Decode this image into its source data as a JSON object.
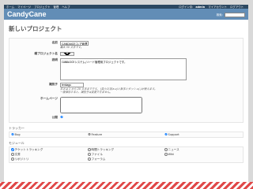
{
  "topbar": {
    "menu": [
      "ホーム",
      "マイページ",
      "プロジェクト",
      "管理",
      "ヘルプ"
    ],
    "login_label": "ログイン中:",
    "user": "admin",
    "my_account": "マイアカウント",
    "logout": "ログアウト"
  },
  "header": {
    "logo": "CandyCane",
    "search_label": "検索:",
    "search_value": ""
  },
  "page_title": "新しいプロジェクト",
  "form": {
    "name_label": "名前",
    "name_value": "CANDAICEコ-ア管理",
    "name_hint": "最大 30 文字です。",
    "parent_label": "親プロジェクト名",
    "parent_value": "",
    "desc_label": "説明",
    "desc_value": "CANDAICEシステム/ハード管理用プロジェクトです。",
    "identifier_label": "識別子",
    "identifier_value": "tenkagu",
    "identifier_hint1": "長さは 1 から 20 文字までです。 (英小文字(a-z)と数字とダッシュ(-)が使えます。",
    "identifier_hint2": "一度保存すると、識別子は変更できません。",
    "homepage_label": "ホームページ",
    "homepage_value": "",
    "public_label": "公開"
  },
  "trackers": {
    "title": "トラッカー",
    "items": [
      {
        "label": "Bug",
        "checked": true
      },
      {
        "label": "Feature",
        "checked": false
      },
      {
        "label": "Support",
        "checked": true
      }
    ]
  },
  "modules": {
    "title": "モジュール",
    "items": [
      {
        "label": "チケットトラッキング",
        "checked": true
      },
      {
        "label": "時間トラッキング",
        "checked": false
      },
      {
        "label": "ニュース",
        "checked": false
      },
      {
        "label": "文書",
        "checked": false
      },
      {
        "label": "ファイル",
        "checked": false
      },
      {
        "label": "Wiki",
        "checked": false
      },
      {
        "label": "リポジトリ",
        "checked": false
      },
      {
        "label": "フォーラム",
        "checked": false
      }
    ]
  }
}
